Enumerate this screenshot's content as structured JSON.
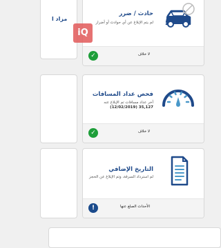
{
  "cards": [
    {
      "title": "حادث / ضرر",
      "desc": "لم يتم الإبلاغ عن أي حوادث أو أضرار",
      "status_text": "لا خلاف",
      "status_icon": "check-icon",
      "icon": "car-damage-icon"
    },
    {
      "title": "فحص عداد المسافات",
      "desc1": "آخر عداد مسافات تم الإبلاغ عنه",
      "desc2": "35,127 (12/02/2019)",
      "status_text": "لا خلاف",
      "status_icon": "check-icon",
      "icon": "odometer-icon"
    },
    {
      "title": "التاريخ الإضافي",
      "desc": "لم استرداد السرقة، وتم الإبلاغ عن الحجز",
      "status_text": "الأحداث الصلغ عنها",
      "status_icon": "info-icon",
      "icon": "document-icon"
    }
  ],
  "side_card": {
    "label": "مزاد ا"
  },
  "watermark": {
    "text": "iQ"
  },
  "colors": {
    "accent": "#1f4a8a",
    "success": "#1e9e3a",
    "info": "#1b4b8c",
    "brand": "#e25a5a"
  }
}
